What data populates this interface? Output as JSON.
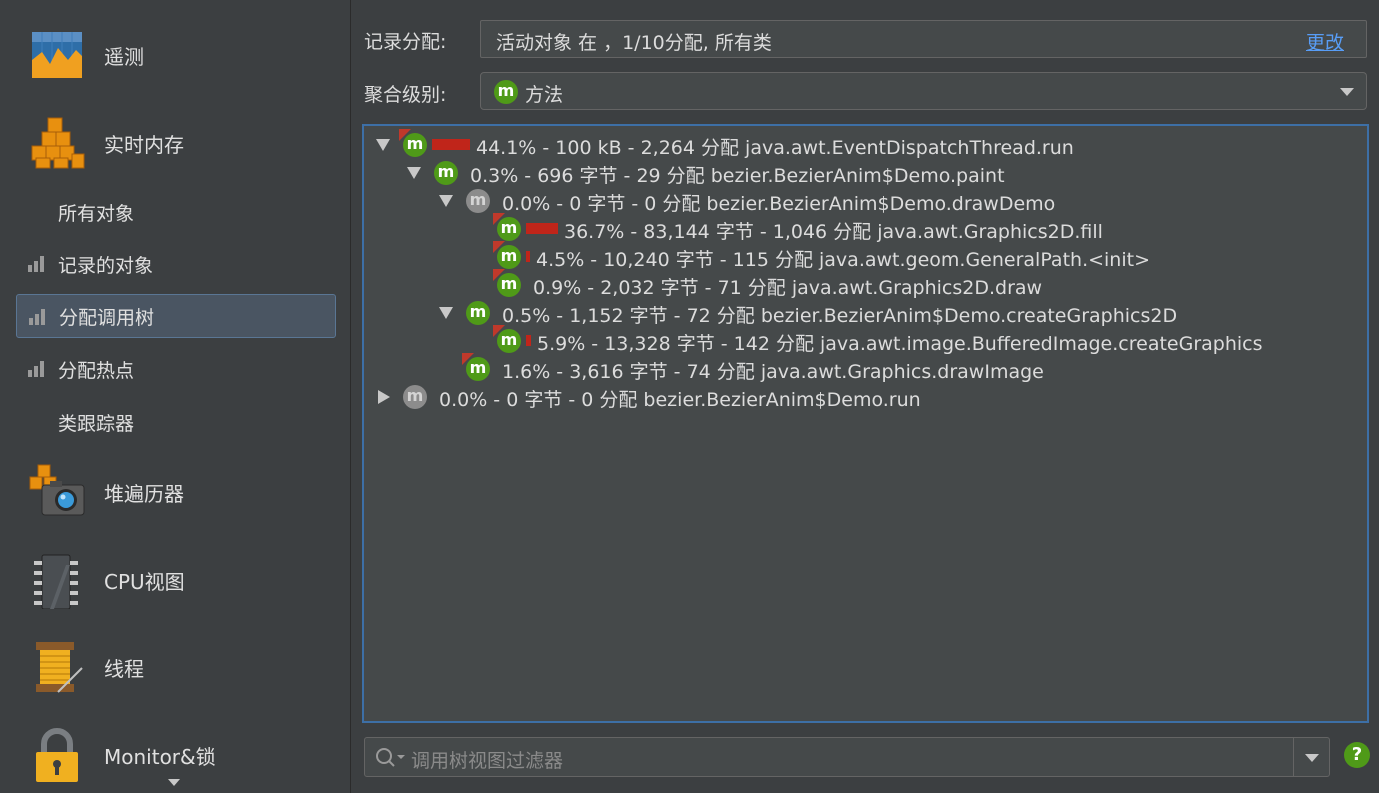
{
  "sidebar": {
    "telemetry": "遥测",
    "live_memory": "实时内存",
    "all_objects": "所有对象",
    "recorded_objects": "记录的对象",
    "allocation_call_tree": "分配调用树",
    "allocation_hot_spots": "分配热点",
    "class_tracker": "类跟踪器",
    "heap_walker": "堆遍历器",
    "cpu_views": "CPU视图",
    "threads": "线程",
    "monitors_locks": "Monitor&锁"
  },
  "record": {
    "label": "记录分配:",
    "value": "活动对象 在 ，1/10分配, 所有类",
    "change_link": "更改"
  },
  "aggregation": {
    "label": "聚合级别:",
    "icon_letter": "m",
    "value": "方法"
  },
  "tree": {
    "rows": [
      {
        "text": "44.1% - 100 kB - 2,264 分配 java.awt.EventDispatchThread.run"
      },
      {
        "text": "0.3% - 696 字节 - 29 分配 bezier.BezierAnim$Demo.paint"
      },
      {
        "text": "0.0% - 0 字节 - 0 分配 bezier.BezierAnim$Demo.drawDemo"
      },
      {
        "text": "36.7% - 83,144 字节 - 1,046 分配 java.awt.Graphics2D.fill"
      },
      {
        "text": "4.5% - 10,240 字节 - 115 分配 java.awt.geom.GeneralPath.<init>"
      },
      {
        "text": "0.9% - 2,032 字节 - 71 分配 java.awt.Graphics2D.draw"
      },
      {
        "text": "0.5% - 1,152 字节 - 72 分配 bezier.BezierAnim$Demo.createGraphics2D"
      },
      {
        "text": "5.9% - 13,328 字节 - 142 分配 java.awt.image.BufferedImage.createGraphics"
      },
      {
        "text": "1.6% - 3,616 字节 - 74 分配 java.awt.Graphics.drawImage"
      },
      {
        "text": "0.0% - 0 字节 - 0 分配 bezier.BezierAnim$Demo.run"
      }
    ],
    "method_icon_letter": "m"
  },
  "filter": {
    "placeholder": "调用树视图过滤器"
  },
  "help_icon_text": "?",
  "colors": {
    "background": "#3c3f41",
    "accent_green": "#4f9a18",
    "bar_red": "#c0251a",
    "link_blue": "#589df6",
    "selection_border": "#3d6fa6"
  }
}
